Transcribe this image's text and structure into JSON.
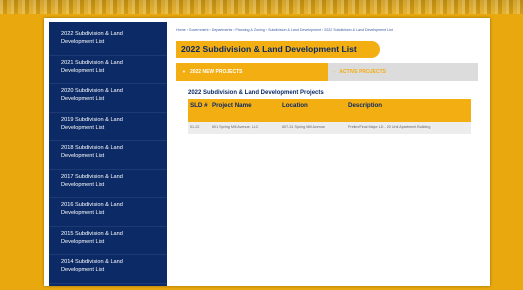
{
  "sidebar": {
    "items": [
      {
        "label": "2022 Subdivision & Land Development List"
      },
      {
        "label": "2021 Subdivision & Land Development List"
      },
      {
        "label": "2020 Subdivision & Land Development List"
      },
      {
        "label": "2019 Subdivision & Land Development List"
      },
      {
        "label": "2018 Subdivision & Land Development List"
      },
      {
        "label": "2017 Subdivision & Land Development List"
      },
      {
        "label": "2016 Subdivision & Land Development List"
      },
      {
        "label": "2015 Subdivision & Land Development List"
      },
      {
        "label": "2014 Subdivision & Land Development List"
      }
    ]
  },
  "breadcrumb": "Home › Government › Departments › Planning & Zoning › Subdivision & Land Development › 2022 Subdivision & Land Development List",
  "page_title": "2022 Subdivision & Land Development List",
  "tabs": {
    "new": {
      "arrow": "▼",
      "label": "2022 NEW PROJECTS"
    },
    "active": {
      "arrow": "›",
      "label": "ACTIVE PROJECTS"
    }
  },
  "section_title": "2022 Subdivision & Land Development Projects",
  "table": {
    "headers": [
      "SLD #",
      "Project Name",
      "Location",
      "Description"
    ],
    "rows": [
      [
        "01-22",
        "601 Spring Mill Avenue, LLC",
        "607-31 Spring Mill Avenue",
        "Prelim/Final Major LD - 20 Unit Apartment Building"
      ]
    ]
  },
  "colors": {
    "brand_navy": "#0b2a66",
    "accent_gold": "#f3ae12",
    "background_gold": "#e8a80e"
  }
}
